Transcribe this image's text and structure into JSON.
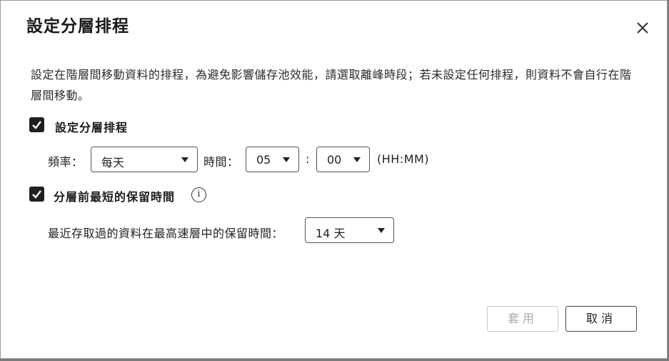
{
  "dialog": {
    "title": "設定分層排程",
    "close_icon": "close-icon",
    "description": "設定在階層間移動資料的排程，為避免影響儲存池效能，請選取離峰時段；若未設定任何排程，則資料不會自行在階層間移動。"
  },
  "schedule": {
    "checkbox_label": "設定分層排程",
    "checked": true,
    "frequency_label": "頻率：",
    "frequency_value": "每天",
    "time_label": "時間：",
    "hour_value": "05",
    "colon": ":",
    "minute_value": "00",
    "time_format": "(HH:MM)"
  },
  "retention": {
    "checkbox_label": "分層前最短的保留時間",
    "checked": true,
    "info_icon": "info-icon",
    "info_symbol": "i",
    "field_label": "最近存取過的資料在最高速層中的保留時間：",
    "value": "14 天"
  },
  "buttons": {
    "apply_label": "套用",
    "apply_enabled": false,
    "cancel_label": "取消"
  }
}
